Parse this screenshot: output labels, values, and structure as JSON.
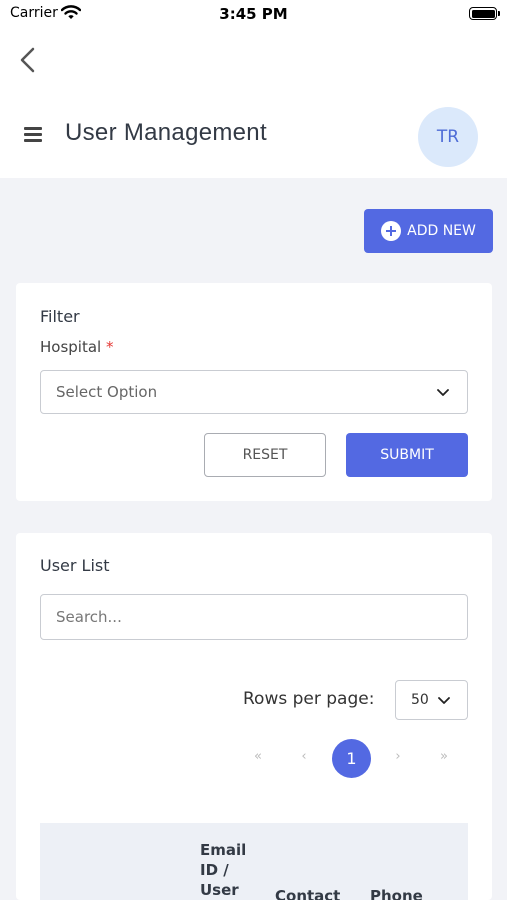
{
  "status_bar": {
    "carrier": "Carrier",
    "time": "3:45 PM"
  },
  "header": {
    "title": "User Management",
    "avatar_initials": "TR"
  },
  "actions": {
    "add_new_label": "ADD NEW"
  },
  "filter": {
    "title": "Filter",
    "hospital_label": "Hospital",
    "required_mark": "*",
    "hospital_placeholder": "Select Option",
    "reset_label": "RESET",
    "submit_label": "SUBMIT"
  },
  "user_list": {
    "title": "User List",
    "search_placeholder": "Search...",
    "rows_per_page_label": "Rows per page:",
    "rows_per_page_value": "50",
    "pagination": {
      "first": "«",
      "prev": "‹",
      "current": "1",
      "next": "›",
      "last": "»"
    },
    "columns": [
      {
        "lines": [
          "Email",
          "ID /",
          "User"
        ]
      },
      {
        "lines": [
          "Contact"
        ]
      },
      {
        "lines": [
          "Phone"
        ]
      }
    ]
  },
  "colors": {
    "accent": "#5369e2",
    "avatar_bg": "#dbe9fb",
    "page_bg": "#f2f3f7"
  },
  "icons": [
    "wifi-icon",
    "battery-icon",
    "back-chevron-icon",
    "menu-icon",
    "plus-circle-icon",
    "chevron-down-icon"
  ]
}
